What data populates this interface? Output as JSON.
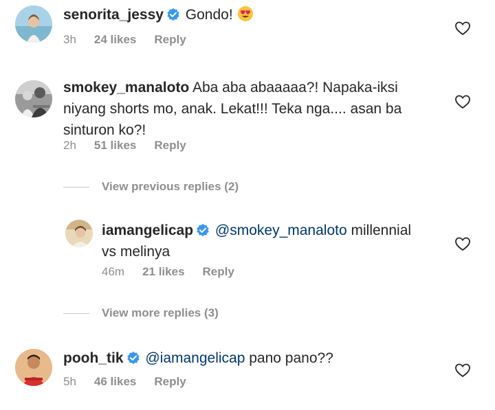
{
  "comments": [
    {
      "username": "senorita_jessy",
      "text": "Gondo!",
      "emoji": "heart-eyes-emoji",
      "time": "3h",
      "likes": "24 likes",
      "reply": "Reply"
    },
    {
      "username": "smokey_manaloto",
      "line1": "Aba aba abaaaaa?! Napaka-iksi",
      "line2": "niyang shorts mo, anak. Lekat!!! Teka nga.... asan ba",
      "line3": "sinturon ko?!",
      "time": "2h",
      "likes": "51 likes",
      "reply": "Reply"
    },
    {
      "username": "iamangelicap",
      "mention": "@smokey_manaloto",
      "line1_rest": "millennial",
      "line2": "vs melinya",
      "time": "46m",
      "likes": "21 likes",
      "reply": "Reply"
    },
    {
      "username": "pooh_tik",
      "mention": "@iamangelicap",
      "text": "pano pano??",
      "time": "5h",
      "likes": "46 likes",
      "reply": "Reply"
    }
  ],
  "view_previous": "View previous replies (2)",
  "view_more": "View more replies (3)",
  "colors": {
    "text": "#262626",
    "meta": "#8e8e8e",
    "mention": "#00376b",
    "verified": "#3897f0"
  }
}
